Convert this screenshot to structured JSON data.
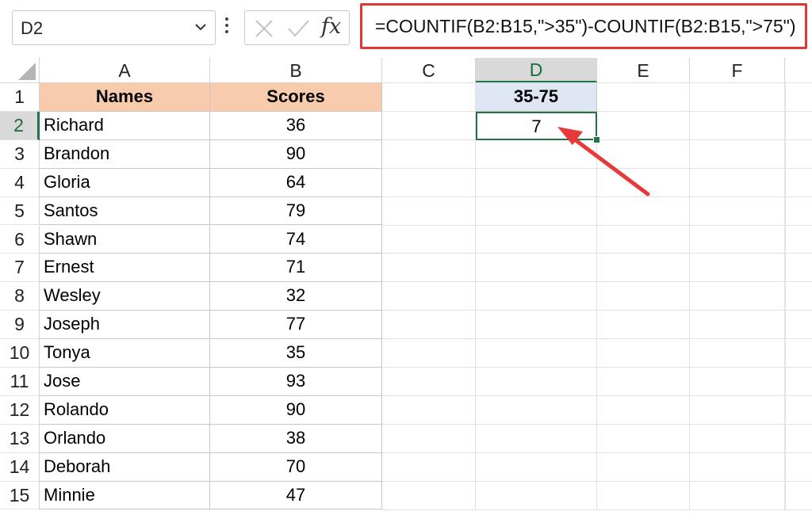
{
  "formula_bar": {
    "name_box": "D2",
    "fx_label": "fx",
    "formula": "=COUNTIF(B2:B15,\">35\")-COUNTIF(B2:B15,\">75\")"
  },
  "columns": [
    "A",
    "B",
    "C",
    "D",
    "E",
    "F"
  ],
  "rows": [
    "1",
    "2",
    "3",
    "4",
    "5",
    "6",
    "7",
    "8",
    "9",
    "10",
    "11",
    "12",
    "13",
    "14",
    "15"
  ],
  "table": {
    "header_names": "Names",
    "header_scores": "Scores",
    "data": [
      {
        "name": "Richard",
        "score": "36"
      },
      {
        "name": "Brandon",
        "score": "90"
      },
      {
        "name": "Gloria",
        "score": "64"
      },
      {
        "name": "Santos",
        "score": "79"
      },
      {
        "name": "Shawn",
        "score": "74"
      },
      {
        "name": "Ernest",
        "score": "71"
      },
      {
        "name": "Wesley",
        "score": "32"
      },
      {
        "name": "Joseph",
        "score": "77"
      },
      {
        "name": "Tonya",
        "score": "35"
      },
      {
        "name": "Jose",
        "score": "93"
      },
      {
        "name": "Rolando",
        "score": "90"
      },
      {
        "name": "Orlando",
        "score": "38"
      },
      {
        "name": "Deborah",
        "score": "70"
      },
      {
        "name": "Minnie",
        "score": "47"
      }
    ]
  },
  "result": {
    "header": "35-75",
    "value": "7"
  },
  "colors": {
    "selection": "#217346",
    "header_fill_names": "#f8cbad",
    "header_fill_result": "#dde6f2",
    "highlight": "#e03636"
  },
  "icons": [
    "chevron-down-icon",
    "more-options-icon",
    "cancel-icon",
    "enter-icon",
    "insert-function-icon",
    "red-arrow-icon"
  ]
}
